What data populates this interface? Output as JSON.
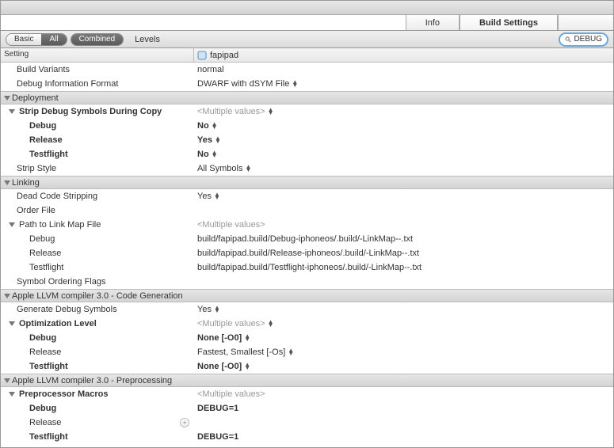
{
  "tabs": {
    "info": "Info",
    "build_settings": "Build Settings"
  },
  "toolbar": {
    "basic": "Basic",
    "all": "All",
    "combined": "Combined",
    "levels": "Levels",
    "search": "DEBUG"
  },
  "header": {
    "setting": "Setting",
    "target": "fapipad"
  },
  "rows": [
    {
      "label": "Build Variants",
      "value": "normal",
      "indent": 20
    },
    {
      "label": "Debug Information Format",
      "value": "DWARF with dSYM File",
      "indent": 20,
      "popup": true
    }
  ],
  "sections": {
    "deployment": "Deployment",
    "linking": "Linking",
    "codegen": "Apple LLVM compiler 3.0 - Code Generation",
    "preproc": "Apple LLVM compiler 3.0 - Preprocessing"
  },
  "strip": {
    "title": "Strip Debug Symbols During Copy",
    "multi": "<Multiple values>",
    "debug": {
      "l": "Debug",
      "v": "No"
    },
    "release": {
      "l": "Release",
      "v": "Yes"
    },
    "testflight": {
      "l": "Testflight",
      "v": "No"
    }
  },
  "stripstyle": {
    "l": "Strip Style",
    "v": "All Symbols"
  },
  "dead": {
    "l": "Dead Code Stripping",
    "v": "Yes"
  },
  "order": {
    "l": "Order File"
  },
  "linkmap": {
    "title": "Path to Link Map File",
    "multi": "<Multiple values>",
    "debug": {
      "l": "Debug",
      "v": "build/fapipad.build/Debug-iphoneos/.build/-LinkMap--.txt"
    },
    "release": {
      "l": "Release",
      "v": "build/fapipad.build/Release-iphoneos/.build/-LinkMap--.txt"
    },
    "testflight": {
      "l": "Testflight",
      "v": "build/fapipad.build/Testflight-iphoneos/.build/-LinkMap--.txt"
    }
  },
  "symorder": {
    "l": "Symbol Ordering Flags"
  },
  "gensym": {
    "l": "Generate Debug Symbols",
    "v": "Yes"
  },
  "opt": {
    "title": "Optimization Level",
    "multi": "<Multiple values>",
    "debug": {
      "l": "Debug",
      "v": "None [-O0]"
    },
    "release": {
      "l": "Release",
      "v": "Fastest, Smallest [-Os]"
    },
    "testflight": {
      "l": "Testflight",
      "v": "None [-O0]"
    }
  },
  "macros": {
    "title": "Preprocessor Macros",
    "multi": "<Multiple values>",
    "debug": {
      "l": "Debug",
      "v": "DEBUG=1"
    },
    "release": {
      "l": "Release",
      "v": ""
    },
    "testflight": {
      "l": "Testflight",
      "v": "DEBUG=1"
    }
  }
}
